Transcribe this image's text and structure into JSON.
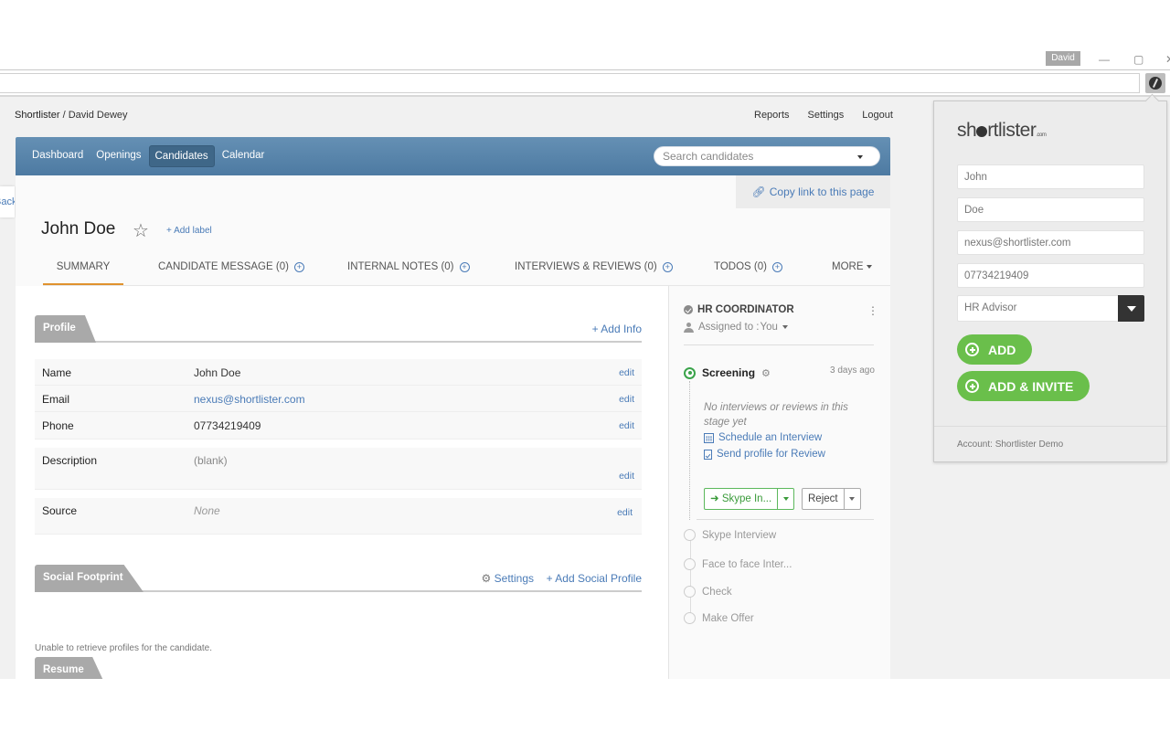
{
  "window": {
    "user_badge": "David",
    "minimize": "—",
    "restore": "▢",
    "close": "✕"
  },
  "breadcrumb": {
    "org": "Shortlister",
    "separator": " / ",
    "user": "David Dewey"
  },
  "top_links": [
    "Reports",
    "Settings",
    "Logout"
  ],
  "back_tab": "Back",
  "nav": {
    "items": [
      {
        "label": "Dashboard",
        "active": false
      },
      {
        "label": "Openings",
        "active": false
      },
      {
        "label": "Candidates",
        "active": true
      },
      {
        "label": "Calendar",
        "active": false
      }
    ],
    "search_placeholder": "Search candidates"
  },
  "copy_link": {
    "icon": "link-icon",
    "label": "Copy link to this page"
  },
  "candidate": {
    "name": "John Doe",
    "star_icon": "☆",
    "add_label": "+ Add label"
  },
  "tabs": [
    {
      "label": "SUMMARY",
      "active": true,
      "has_add": false
    },
    {
      "label": "CANDIDATE MESSAGE (0)",
      "has_add": true
    },
    {
      "label": "INTERNAL NOTES (0)",
      "has_add": true
    },
    {
      "label": "INTERVIEWS & REVIEWS (0)",
      "has_add": true
    },
    {
      "label": "TODOS (0)",
      "has_add": true
    },
    {
      "label": "MORE",
      "dropdown": true
    }
  ],
  "profile": {
    "title": "Profile",
    "action": "+ Add Info",
    "rows": [
      {
        "label": "Name",
        "value": "John Doe",
        "edit": "edit"
      },
      {
        "label": "Email",
        "value": "nexus@shortlister.com",
        "edit": "edit",
        "link": true
      },
      {
        "label": "Phone",
        "value": "07734219409",
        "edit": "edit"
      },
      {
        "label": "Description",
        "value": "(blank)",
        "edit": "edit"
      },
      {
        "label": "Source",
        "value": "None",
        "edit": "edit"
      }
    ]
  },
  "social": {
    "title": "Social Footprint",
    "settings": "Settings",
    "add": "+ Add Social Profile",
    "message": "Unable to retrieve profiles for the candidate."
  },
  "resume": {
    "title": "Resume"
  },
  "pipeline": {
    "title": "HR COORDINATOR",
    "assigned_prefix": "Assigned to : ",
    "assigned_to": "You",
    "current_stage": "Screening",
    "current_time": "3 days ago",
    "empty_message": "No interviews or reviews in this stage yet",
    "schedule_link": "Schedule an Interview",
    "review_link": "Send profile for Review",
    "move_button": "➜ Skype In...",
    "reject_button": "Reject",
    "future_stages": [
      "Skype Interview",
      "Face to face Inter...",
      "Check",
      "Make Offer"
    ]
  },
  "popup": {
    "logo_pre": "sh",
    "logo_post": "rtlister",
    "logo_suffix": ".com",
    "first_name": "John",
    "last_name": "Doe",
    "email": "nexus@shortlister.com",
    "phone": "07734219409",
    "role": "HR Advisor",
    "add_button": "ADD",
    "add_invite_button": "ADD & INVITE",
    "account": "Account: Shortlister Demo"
  },
  "colors": {
    "nav_blue": "#5783aa",
    "link_blue": "#4a7bb7",
    "active_tab_underline": "#e0922e",
    "stage_green": "#3aa34a",
    "popup_button_green": "#6abf4b"
  }
}
